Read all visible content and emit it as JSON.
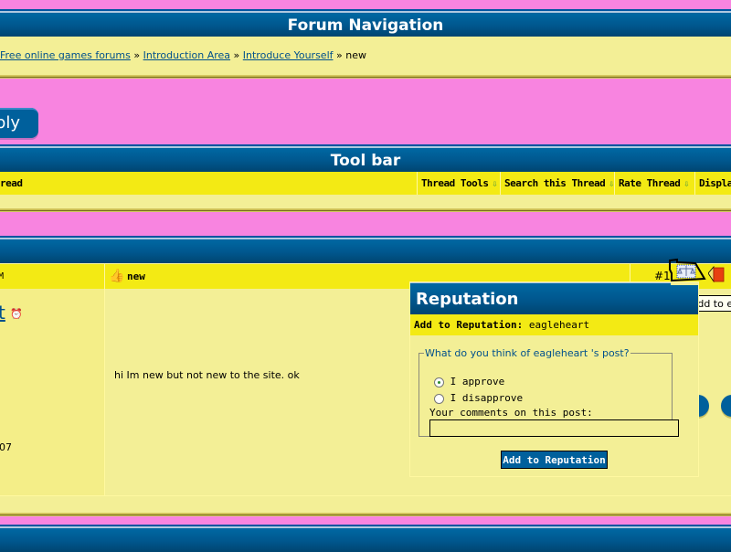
{
  "nav": {
    "title": "Forum Navigation",
    "breadcrumb": [
      {
        "label": "Free online games forums",
        "link": true
      },
      {
        "label": "Introduction Area",
        "link": true
      },
      {
        "label": "Introduce Yourself",
        "link": true
      }
    ],
    "separator": "»",
    "current": "new"
  },
  "reply_button": {
    "label": "ply"
  },
  "toolbar": {
    "title": "Tool bar",
    "left_label": "read",
    "items": [
      {
        "label": "Thread Tools",
        "icon": "arrow-down-icon"
      },
      {
        "label": "Search this Thread",
        "icon": "arrow-down-icon"
      },
      {
        "label": "Rate Thread",
        "icon": "arrow-down-icon"
      },
      {
        "label": "Display",
        "icon": "arrow-down-icon"
      }
    ]
  },
  "post": {
    "header_left": "M",
    "title": "new",
    "title_icon": "thumbs-up-icon",
    "post_number": "#1",
    "username_fragment": "t",
    "status_icon": "alarm-clock-icon",
    "join_date_fragment": "07",
    "body": "hi Im new but not new to the site. ok"
  },
  "tooltip": {
    "text": "Add to ea"
  },
  "reputation": {
    "title": "Reputation",
    "add_label": "Add to Reputation:",
    "username": "eagleheart",
    "legend": "What do you think of eagleheart 's post?",
    "options": [
      {
        "label": "I approve",
        "selected": true
      },
      {
        "label": "I disapprove",
        "selected": false
      }
    ],
    "comments_label": "Your comments on this post:",
    "comments_value": "",
    "submit_label": "Add to Reputation"
  },
  "colors": {
    "page_background": "#f884e0",
    "header_blue": "#00578e",
    "cream": "#f3ef96",
    "yellow": "#f3ea14",
    "link": "#00508c"
  }
}
